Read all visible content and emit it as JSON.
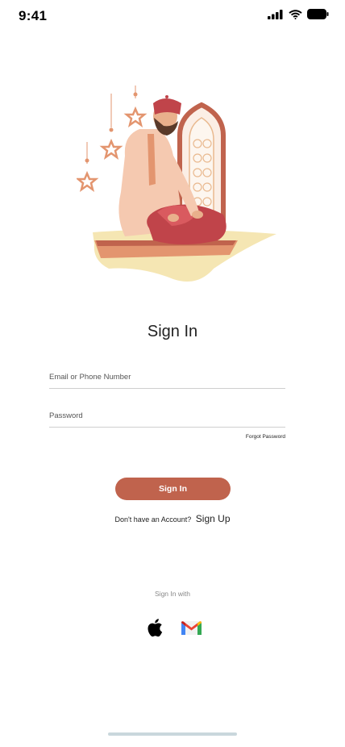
{
  "status_bar": {
    "time": "9:41",
    "icons": [
      "signal-icon",
      "wifi-icon",
      "battery-icon"
    ]
  },
  "illustration": {
    "subject": "prayer-illustration",
    "colors": {
      "terracotta": "#c0634d",
      "peach": "#f2c0a4",
      "sand": "#f5e6b3",
      "pattern": "#e9b98f"
    }
  },
  "form": {
    "title": "Sign In",
    "email_placeholder": "Email or Phone Number",
    "password_placeholder": "Password",
    "forgot_label": "Forgot Password",
    "submit_label": "Sign In"
  },
  "signup": {
    "prompt": "Don't have an Account?",
    "link": "Sign Up"
  },
  "social": {
    "label": "Sign In with",
    "providers": [
      {
        "name": "Apple",
        "icon": "apple-icon"
      },
      {
        "name": "Gmail",
        "icon": "gmail-icon"
      }
    ]
  },
  "theme": {
    "accent": "#c0634d",
    "home_indicator": "#c9d7dc"
  }
}
